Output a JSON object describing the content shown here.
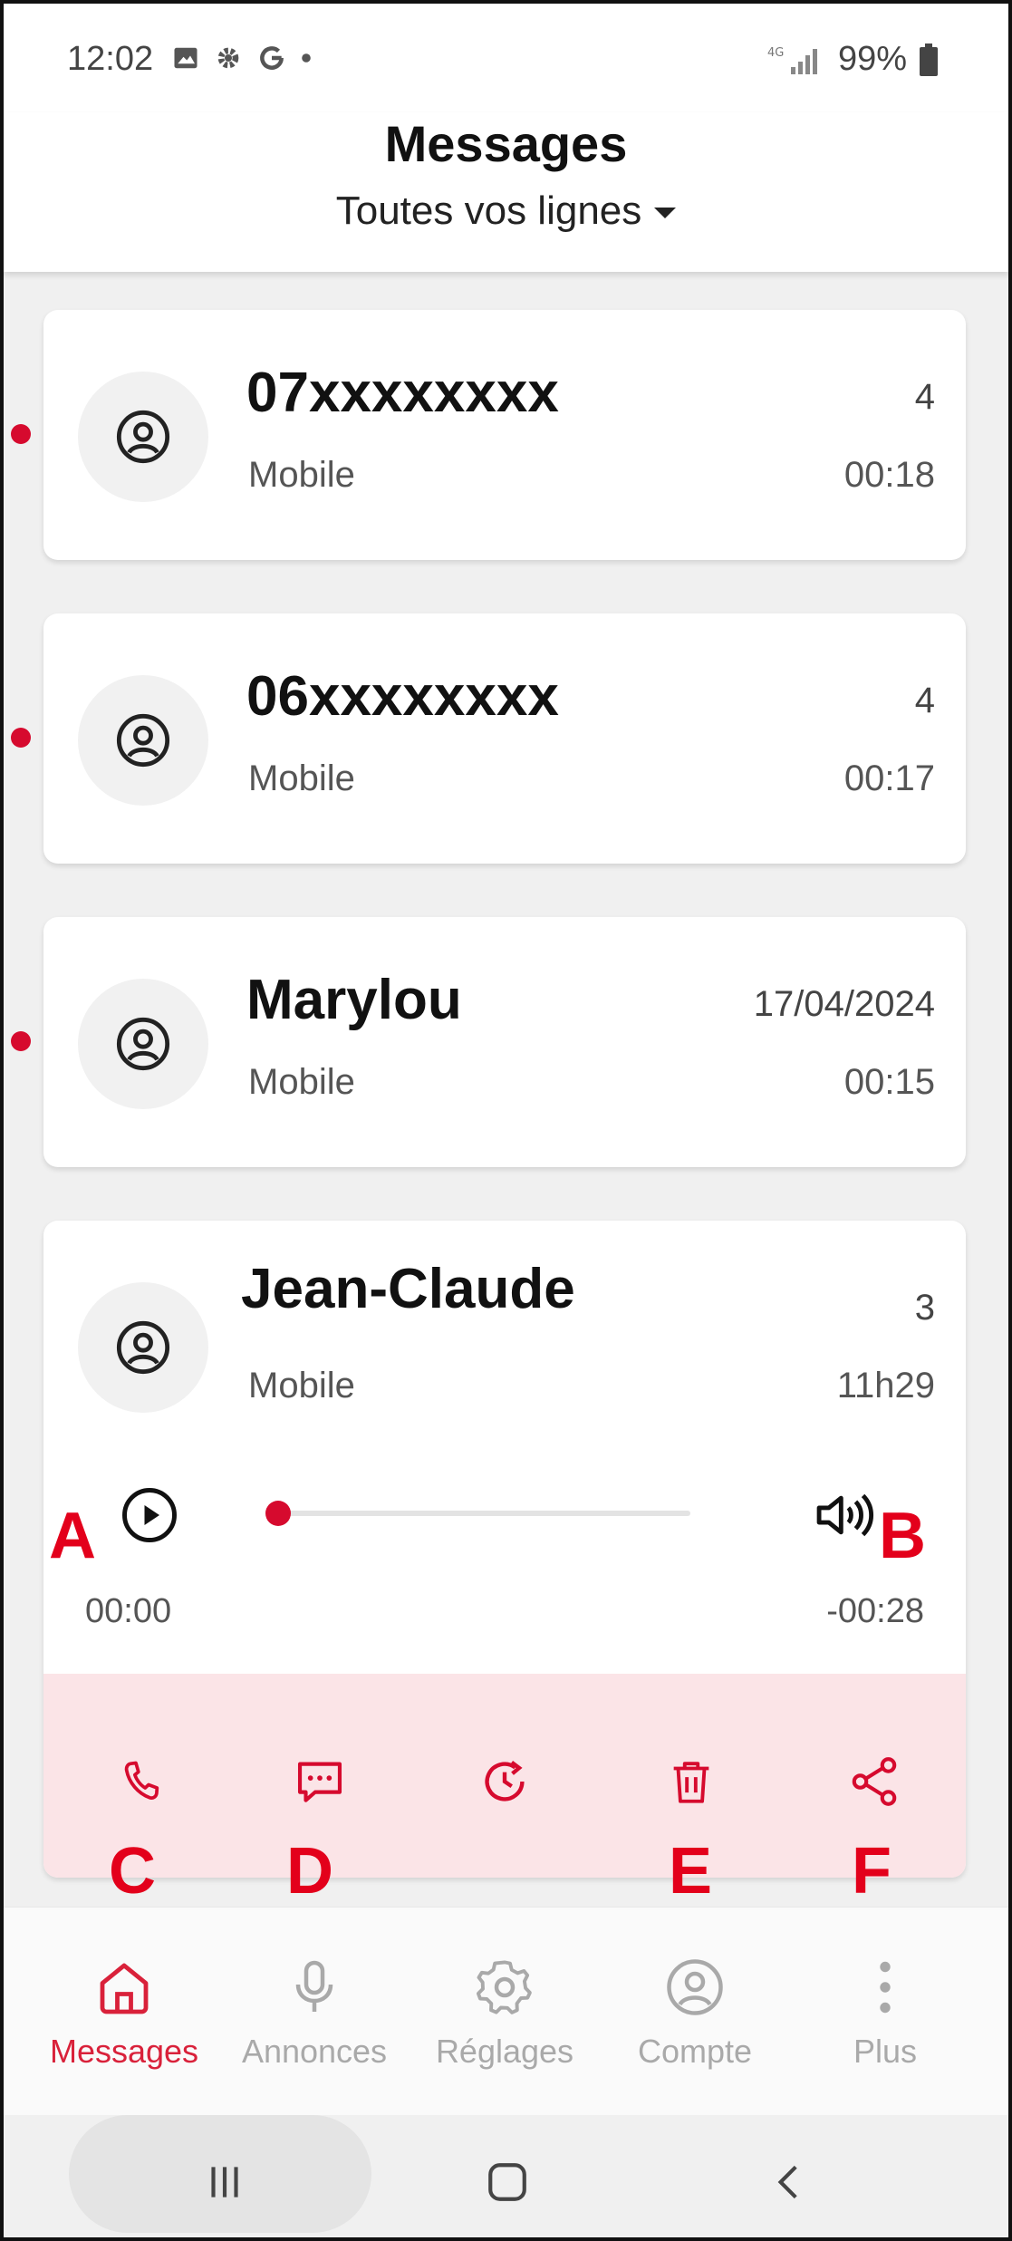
{
  "status_bar": {
    "time": "12:02",
    "battery": "99%"
  },
  "header": {
    "title": "Messages",
    "line_selector": "Toutes vos lignes"
  },
  "messages": [
    {
      "caller": "07xxxxxxxx",
      "type": "Mobile",
      "meta": "4",
      "duration": "00:18",
      "unread": true
    },
    {
      "caller": "06xxxxxxxx",
      "type": "Mobile",
      "meta": "4",
      "duration": "00:17",
      "unread": true
    },
    {
      "caller": "Marylou",
      "type": "Mobile",
      "meta": "17/04/2024",
      "duration": "00:15",
      "unread": true
    },
    {
      "caller": "Jean-Claude",
      "type": "Mobile",
      "meta": "3",
      "duration": "11h29",
      "unread": false
    }
  ],
  "player": {
    "elapsed": "00:00",
    "remaining": "-00:28",
    "progress_percent": 2
  },
  "annotations": {
    "play": "A",
    "volume": "B",
    "call": "C",
    "sms": "D",
    "delete": "E",
    "share": "F"
  },
  "bottom_nav": {
    "items": [
      {
        "label": "Messages",
        "icon": "home-icon",
        "active": true
      },
      {
        "label": "Annonces",
        "icon": "microphone-icon",
        "active": false
      },
      {
        "label": "Réglages",
        "icon": "gear-icon",
        "active": false
      },
      {
        "label": "Compte",
        "icon": "account-icon",
        "active": false
      },
      {
        "label": "Plus",
        "icon": "more-vertical-icon",
        "active": false
      }
    ]
  },
  "colors": {
    "accent": "#d60a2e",
    "annotation": "#e3001b",
    "action_bg": "#fbe4e7"
  }
}
